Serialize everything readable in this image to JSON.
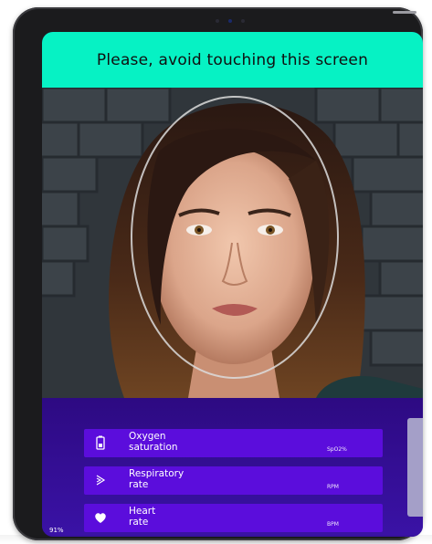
{
  "banner": {
    "text": "Please, avoid touching this screen"
  },
  "camera": {
    "subject": "face-in-oval-guide"
  },
  "metrics": [
    {
      "line1": "Oxygen",
      "line2": "saturation",
      "unit": "SpO2%",
      "icon": "oxygen-icon"
    },
    {
      "line1": "Respiratory",
      "line2": "rate",
      "unit": "RPM",
      "icon": "respiratory-icon"
    },
    {
      "line1": "Heart",
      "line2": "rate",
      "unit": "BPM",
      "icon": "heart-icon"
    }
  ],
  "status": {
    "battery": "91%"
  },
  "colors": {
    "banner": "#06f2c4",
    "panel": "#2d0a82",
    "card": "#5b0ddc",
    "scroll": "#a49fc8"
  }
}
